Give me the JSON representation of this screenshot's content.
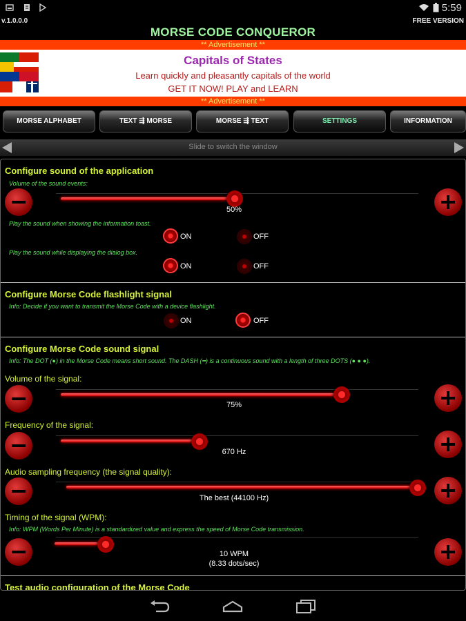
{
  "status": {
    "time": "5:59"
  },
  "header": {
    "version": "v.1.0.0.0",
    "free_label": "FREE VERSION",
    "title": "MORSE CODE CONQUEROR"
  },
  "ad": {
    "strip_text": "** Advertisement **",
    "title": "Capitals of States",
    "line1": "Learn quickly and pleasantly capitals of the world",
    "line2": "GET IT NOW! PLAY and LEARN"
  },
  "tabs": [
    {
      "label": "MORSE ALPHABET"
    },
    {
      "label": "TEXT ⇶ MORSE"
    },
    {
      "label": "MORSE ⇶ TEXT"
    },
    {
      "label": "SETTINGS",
      "active": true
    },
    {
      "label": "INFORMATION"
    }
  ],
  "slide_hint": "Slide to switch the window",
  "sound_app": {
    "title": "Configure sound of the application",
    "volume_label": "Volume of the sound events:",
    "volume_value": "50%",
    "volume_fraction": 0.5,
    "toast_label": "Play the sound when showing the information toast.",
    "dialog_label": "Play the sound while displaying the dialog box.",
    "on_label": "ON",
    "off_label": "OFF",
    "toast_on": true,
    "dialog_on": true
  },
  "flashlight": {
    "title": "Configure Morse Code flashlight signal",
    "info": "Info: Decide if you want to transmit the Morse Code with a device flashlight.",
    "on": false
  },
  "sound_signal": {
    "title": "Configure Morse Code sound signal",
    "info": "Info: The DOT (●) in the Morse Code means short sound. The DASH (━) is a continuous sound with a length of three DOTS (● ● ●).",
    "volume_label": "Volume of the signal:",
    "volume_value": "75%",
    "volume_fraction": 0.75,
    "frequency_label": "Frequency of the signal:",
    "frequency_value": "670 Hz",
    "frequency_fraction": 0.33,
    "sampling_label": "Audio sampling frequency (the signal quality):",
    "sampling_value": "The best (44100 Hz)",
    "sampling_fraction": 1.0,
    "timing_label": "Timing of the signal (WPM):",
    "timing_info": "Info: WPM (Words Per Minute) is a standardized value and express the speed of Morse Code transmission.",
    "timing_value": "10 WPM",
    "timing_sub": "(8.33 dots/sec)",
    "timing_fraction": 0.14
  },
  "test_section": {
    "title": "Test audio configuration of the Morse Code"
  },
  "colors": {
    "accent": "#d7f23a",
    "info": "#5ee35e",
    "title": "#9ff6a0",
    "red": "#d30000",
    "ad_strip": "#ff3d00"
  }
}
